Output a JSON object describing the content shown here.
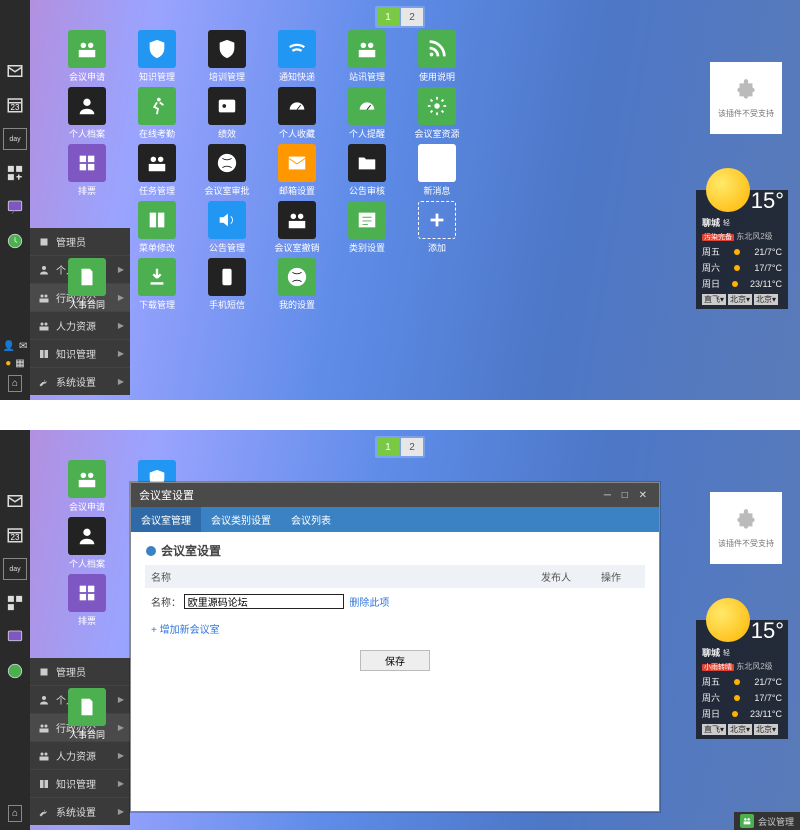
{
  "pager": {
    "p1_icon": "👥",
    "p1": "1",
    "p2": "2"
  },
  "sidebar": {
    "icons": [
      "mail-icon",
      "calendar-icon",
      "day-icon",
      "grid-icon",
      "chat-icon",
      "clock-icon"
    ],
    "cal_num": "23",
    "day_text": "day"
  },
  "menu": {
    "items": [
      {
        "label": "管理员",
        "icon": "square"
      },
      {
        "label": "个人办公",
        "icon": "user",
        "arrow": true
      },
      {
        "label": "行政办公",
        "icon": "people",
        "arrow": true,
        "hl": true
      },
      {
        "label": "人力资源",
        "icon": "people",
        "arrow": true
      },
      {
        "label": "知识管理",
        "icon": "book",
        "arrow": true
      },
      {
        "label": "系统设置",
        "icon": "wrench",
        "arrow": true
      }
    ]
  },
  "tiles": [
    {
      "label": "会议申请",
      "color": "#4caf50",
      "icon": "people"
    },
    {
      "label": "知识管理",
      "color": "#2196f3",
      "icon": "shield"
    },
    {
      "label": "培训管理",
      "color": "#222",
      "icon": "shield"
    },
    {
      "label": "通知快递",
      "color": "#2196f3",
      "icon": "wifi"
    },
    {
      "label": "站讯管理",
      "color": "#4caf50",
      "icon": "people"
    },
    {
      "label": "使用说明",
      "color": "#4caf50",
      "icon": "rss"
    },
    {
      "label": "",
      "color": "",
      "icon": ""
    },
    {
      "label": "个人档案",
      "color": "#222",
      "icon": "user"
    },
    {
      "label": "在线考勤",
      "color": "#4caf50",
      "icon": "run"
    },
    {
      "label": "绩效",
      "color": "#222",
      "icon": "id"
    },
    {
      "label": "个人收藏",
      "color": "#222",
      "icon": "gauge"
    },
    {
      "label": "个人提醒",
      "color": "#4caf50",
      "icon": "gauge"
    },
    {
      "label": "会议室资源",
      "color": "#4caf50",
      "icon": "gear"
    },
    {
      "label": "",
      "color": "",
      "icon": ""
    },
    {
      "label": "排票",
      "color": "#7e57c2",
      "icon": "grid"
    },
    {
      "label": "任务管理",
      "color": "#222",
      "icon": "people"
    },
    {
      "label": "会议室审批",
      "color": "#222",
      "icon": "xbox"
    },
    {
      "label": "邮箱设置",
      "color": "#ff9800",
      "icon": "mail"
    },
    {
      "label": "公告审核",
      "color": "#222",
      "icon": "folder"
    },
    {
      "label": "新消息",
      "color": "#fff",
      "icon": "mail-dark",
      "fg": "#222",
      "border": true
    },
    {
      "label": "",
      "color": "",
      "icon": ""
    },
    {
      "label": "",
      "color": "",
      "icon": ""
    },
    {
      "label": "菜单修改",
      "color": "#4caf50",
      "icon": "book"
    },
    {
      "label": "公告管理",
      "color": "#2196f3",
      "icon": "vol"
    },
    {
      "label": "会议室撤销",
      "color": "#222",
      "icon": "people"
    },
    {
      "label": "类别设置",
      "color": "#4caf50",
      "icon": "list"
    },
    {
      "label": "添加",
      "color": "transparent",
      "icon": "plus",
      "border": true,
      "fg": "#fff"
    },
    {
      "label": "",
      "color": "",
      "icon": ""
    },
    {
      "label": "人事合同",
      "color": "#4caf50",
      "icon": "doc"
    },
    {
      "label": "下载管理",
      "color": "#4caf50",
      "icon": "dl"
    },
    {
      "label": "手机短信",
      "color": "#222",
      "icon": "phone"
    },
    {
      "label": "我的设置",
      "color": "#4caf50",
      "icon": "xbox"
    },
    {
      "label": "",
      "color": "",
      "icon": ""
    },
    {
      "label": "",
      "color": "",
      "icon": ""
    },
    {
      "label": "",
      "color": "",
      "icon": ""
    }
  ],
  "plugin": {
    "text": "该插件不受支持"
  },
  "weather": {
    "city": "聊城",
    "qual": "轻",
    "alert1": "污染完备",
    "alert1_class": "b-red",
    "alert2": "东北风2级",
    "temp": "15°",
    "rows": [
      {
        "d": "周五",
        "t": "21/7°C"
      },
      {
        "d": "周六",
        "t": "17/7°C"
      },
      {
        "d": "周日",
        "t": "23/11°C"
      }
    ],
    "sel": [
      "直飞▾",
      "北京▾",
      "北京▾"
    ]
  },
  "weather2_alert1": "小雨转晴",
  "dialog": {
    "title": "会议室设置",
    "tabs": [
      "会议室管理",
      "会议类别设置",
      "会议列表"
    ],
    "section": "会议室设置",
    "th": [
      "名称",
      "发布人",
      "操作"
    ],
    "row_label": "名称：",
    "row_value": "欧里源码论坛",
    "row_action": "删除此项",
    "add_link": "+ 增加新会议室",
    "save": "保存"
  },
  "status": {
    "label": "会议管理"
  }
}
